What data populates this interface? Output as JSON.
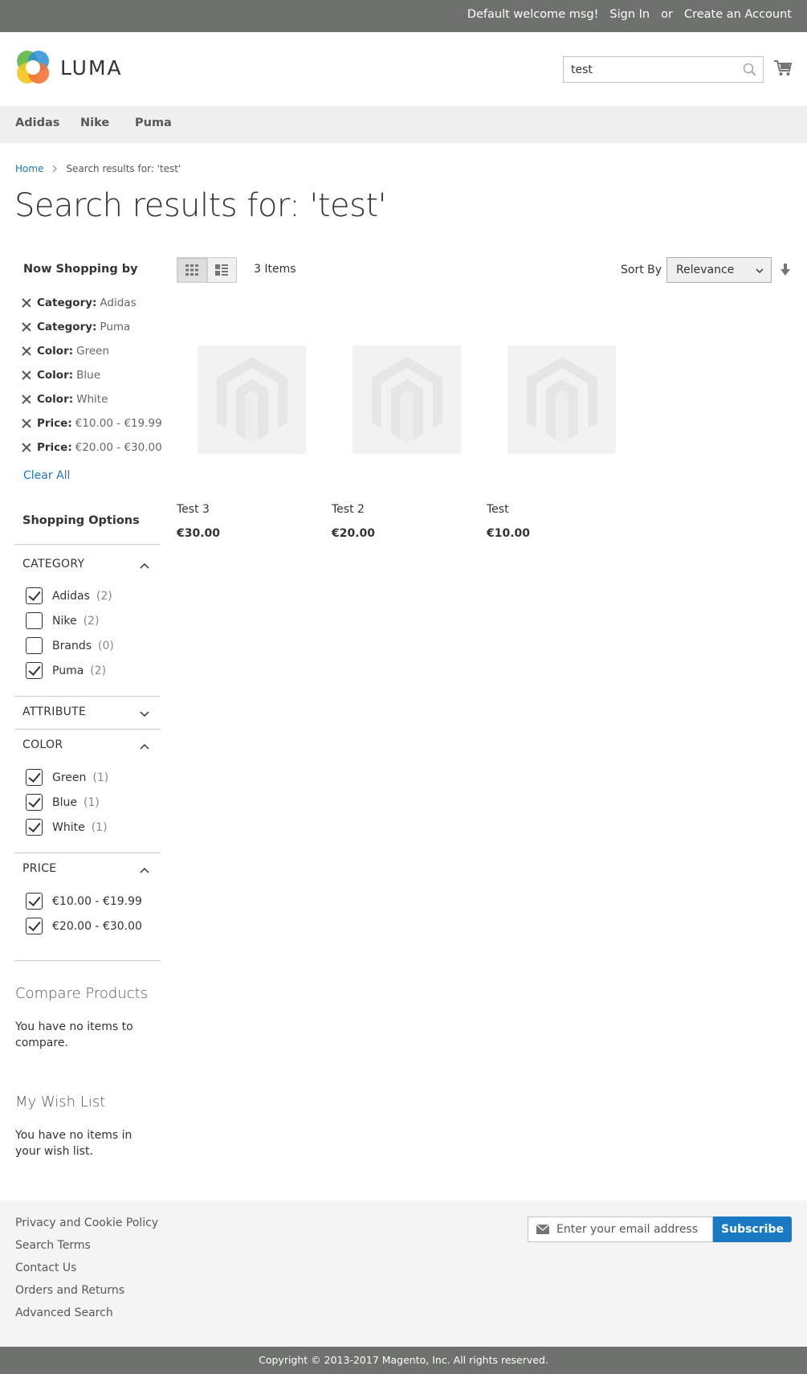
{
  "topbar": {
    "welcome": "Default welcome msg!",
    "sign_in": "Sign In",
    "or": "or",
    "create_account": "Create an Account"
  },
  "header": {
    "logo_text": "LUMA",
    "search_value": "test"
  },
  "nav": [
    "Adidas",
    "Nike",
    "Puma"
  ],
  "breadcrumb": {
    "home": "Home",
    "current": "Search results for: 'test'"
  },
  "page_title": "Search results for: 'test'",
  "now_shopping": {
    "title": "Now Shopping by",
    "filters": [
      {
        "label": "Category:",
        "value": "Adidas"
      },
      {
        "label": "Category:",
        "value": "Puma"
      },
      {
        "label": "Color:",
        "value": "Green"
      },
      {
        "label": "Color:",
        "value": "Blue"
      },
      {
        "label": "Color:",
        "value": "White"
      },
      {
        "label": "Price:",
        "value": "€10.00 - €19.99"
      },
      {
        "label": "Price:",
        "value": "€20.00 - €30.00"
      }
    ],
    "clear_all": "Clear All"
  },
  "shopping_options": {
    "title": "Shopping Options",
    "category": {
      "title": "Category",
      "expanded": true,
      "options": [
        {
          "name": "Adidas",
          "count": "(2)",
          "checked": true
        },
        {
          "name": "Nike",
          "count": "(2)",
          "checked": false
        },
        {
          "name": "Brands",
          "count": "(0)",
          "checked": false
        },
        {
          "name": "Puma",
          "count": "(2)",
          "checked": true
        }
      ]
    },
    "attribute": {
      "title": "Attribute",
      "expanded": false
    },
    "color": {
      "title": "Color",
      "expanded": true,
      "options": [
        {
          "name": "Green",
          "count": "(1)",
          "checked": true
        },
        {
          "name": "Blue",
          "count": "(1)",
          "checked": true
        },
        {
          "name": "White",
          "count": "(1)",
          "checked": true
        }
      ]
    },
    "price": {
      "title": "Price",
      "expanded": true,
      "options": [
        {
          "name": "€10.00 - €19.99",
          "checked": true
        },
        {
          "name": "€20.00 - €30.00",
          "checked": true
        }
      ]
    }
  },
  "compare": {
    "title": "Compare Products",
    "text": "You have no items to compare."
  },
  "wishlist": {
    "title": "My Wish List",
    "text": "You have no items in your wish list."
  },
  "toolbar": {
    "view_mode": "grid",
    "items_count": "3 Items",
    "sort_label": "Sort By",
    "sort_value": "Relevance"
  },
  "products": [
    {
      "name": "Test 3",
      "price": "€30.00"
    },
    {
      "name": "Test 2",
      "price": "€20.00"
    },
    {
      "name": "Test",
      "price": "€10.00"
    }
  ],
  "footer": {
    "links": [
      "Privacy and Cookie Policy",
      "Search Terms",
      "Contact Us",
      "Orders and Returns",
      "Advanced Search"
    ],
    "newsletter_placeholder": "Enter your email address",
    "subscribe": "Subscribe",
    "copyright": "Copyright © 2013-2017 Magento, Inc. All rights reserved."
  },
  "colors": {
    "topbar": "#6e716e",
    "link": "#1979c3",
    "nav_bg": "#f0f0f0",
    "footer_bg": "#f4f4f4"
  }
}
